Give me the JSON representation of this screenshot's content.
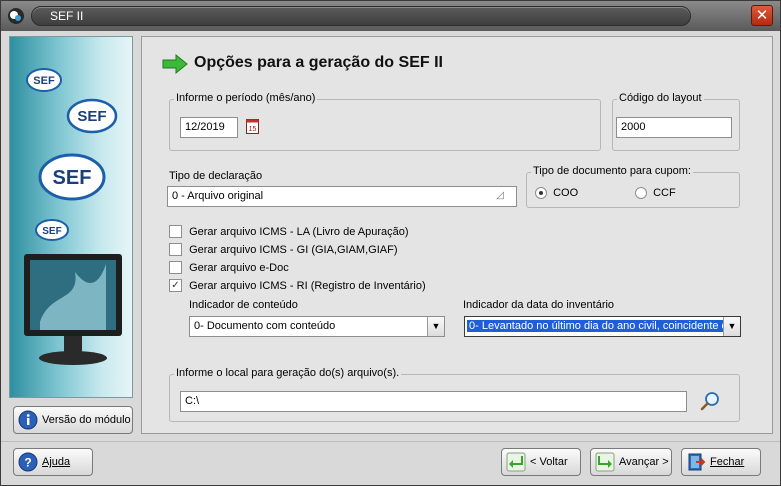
{
  "window": {
    "title": "SEF II",
    "close_symbol": "✕"
  },
  "banner": {
    "logos": [
      "SEF",
      "SEF",
      "SEF",
      "SEF"
    ],
    "module_version_button": "Versão do módulo"
  },
  "header": {
    "title": "Opções para a geração do SEF II"
  },
  "period": {
    "group_label": "Informe o período (mês/ano)",
    "value": "12/2019",
    "calendar_glyph": "15"
  },
  "layout": {
    "group_label": "Código do layout",
    "value": "2000"
  },
  "declaration": {
    "label": "Tipo de declaração",
    "value": "0 - Arquivo original"
  },
  "coupon_doc": {
    "group_label": "Tipo de documento para cupom:",
    "options": [
      {
        "label": "COO",
        "selected": true
      },
      {
        "label": "CCF",
        "selected": false
      }
    ]
  },
  "checkboxes": [
    {
      "label": "Gerar arquivo ICMS - LA (Livro de Apuração)",
      "checked": false
    },
    {
      "label": "Gerar arquivo ICMS - GI (GIA,GIAM,GIAF)",
      "checked": false
    },
    {
      "label": "Gerar arquivo e-Doc",
      "checked": false
    },
    {
      "label": "Gerar arquivo ICMS - RI (Registro de Inventário)",
      "checked": true
    }
  ],
  "content_indicator": {
    "label": "Indicador de conteúdo",
    "value": "0- Documento com conteúdo"
  },
  "inventory_date_indicator": {
    "label": "Indicador da data do inventário",
    "value": "0- Levantado no último dia do ano civil, coincidente c"
  },
  "output_location": {
    "group_label": "Informe o local para geração do(s) arquivo(s).",
    "value": "C:\\"
  },
  "footer": {
    "help_button": "Ajuda",
    "back_button": "< Voltar",
    "next_button": "Avançar >",
    "close_button": "Fechar"
  },
  "colors": {
    "accent_selection": "#1e5fd8",
    "title_arrow": "#3cb83a",
    "close_red": "#c8381c"
  }
}
